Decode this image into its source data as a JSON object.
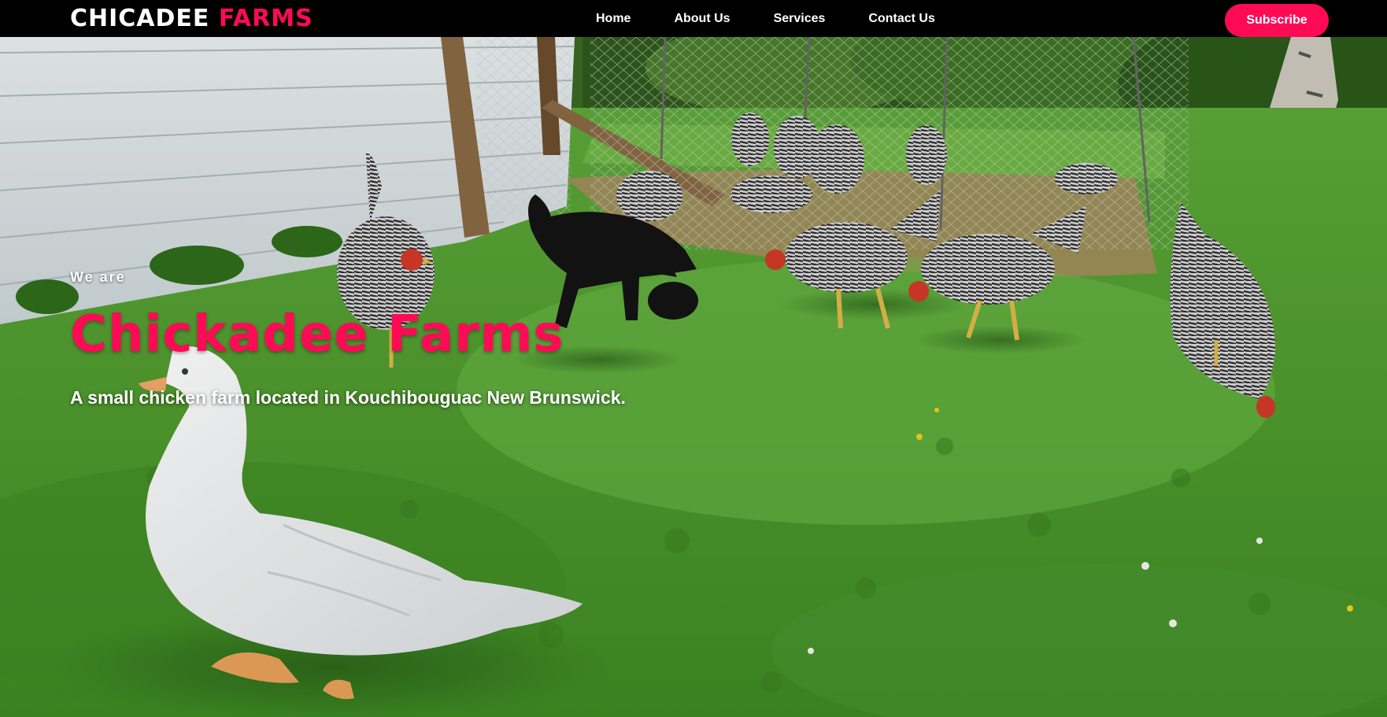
{
  "brand": {
    "logo_part1": "CHICADEE",
    "logo_part2": "FARMS",
    "accent_color": "#ff0a55"
  },
  "nav": {
    "items": [
      {
        "label": "Home"
      },
      {
        "label": "About Us"
      },
      {
        "label": "Services"
      },
      {
        "label": "Contact Us"
      }
    ],
    "subscribe_label": "Subscribe"
  },
  "hero": {
    "eyebrow": "We are",
    "title": "Chickadee Farms",
    "subtitle": "A small chicken farm located in Kouchibouguac New Brunswick.",
    "background_image": "photo of chickens, a black dog and a white duck in a grassy farmyard"
  }
}
